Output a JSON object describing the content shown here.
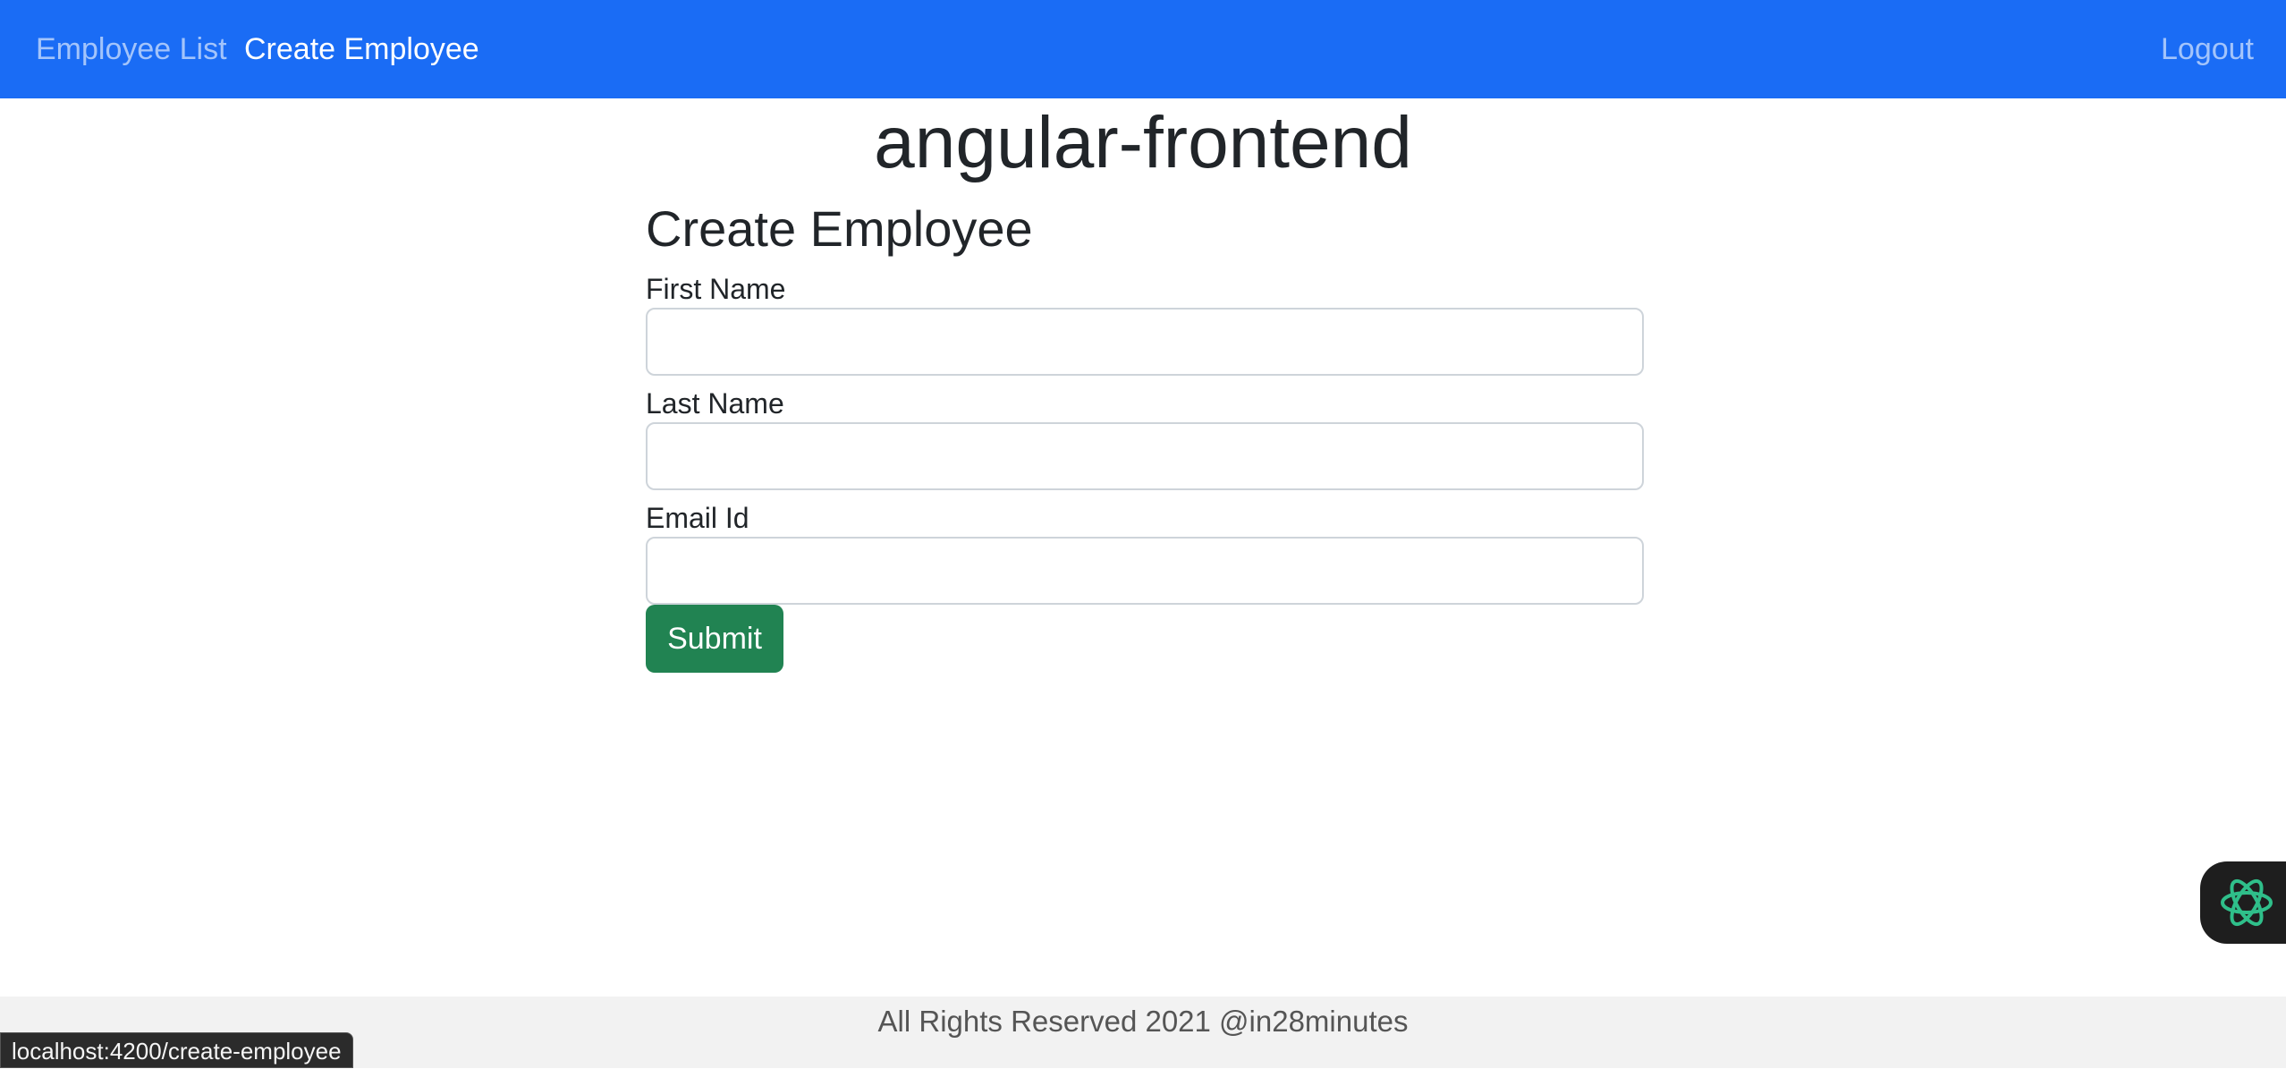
{
  "navbar": {
    "links": [
      {
        "label": "Employee List"
      },
      {
        "label": "Create Employee"
      }
    ],
    "logout_label": "Logout",
    "background_color": "#1a6cf5"
  },
  "app_title": "angular-frontend",
  "form": {
    "title": "Create Employee",
    "fields": [
      {
        "label": "First Name",
        "value": ""
      },
      {
        "label": "Last Name",
        "value": ""
      },
      {
        "label": "Email Id",
        "value": ""
      }
    ],
    "submit_label": "Submit",
    "submit_color": "#218352"
  },
  "footer": {
    "text": "All Rights Reserved 2021 @in28minutes"
  },
  "status_bar": {
    "url": "localhost:4200/create-employee"
  },
  "assistant_widget": {
    "icon": "ai-assistant-icon"
  }
}
